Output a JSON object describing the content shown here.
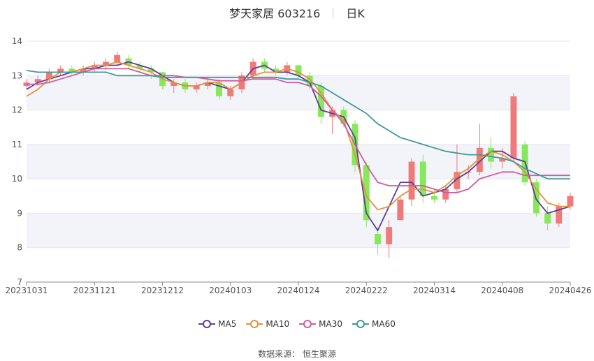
{
  "header": {
    "title": "梦天家居 603216",
    "period": "日K"
  },
  "source": "数据来源：  恒生聚源",
  "chart_data": {
    "type": "candlestick",
    "ylim": [
      7,
      14
    ],
    "yticks": [
      "7",
      "8",
      "9",
      "10",
      "11",
      "12",
      "13",
      "14"
    ],
    "xtick_labels": [
      "20231031",
      "20231121",
      "20231212",
      "20240103",
      "20240124",
      "20240222",
      "20240314",
      "20240408",
      "20240426"
    ],
    "up_color": "#f07a7a",
    "down_color": "#86e85a",
    "series": [
      {
        "name": "MA5",
        "color": "#5b3f93",
        "values": [
          12.6,
          12.8,
          12.9,
          13.0,
          13.1,
          13.2,
          13.2,
          13.3,
          13.3,
          13.4,
          13.3,
          13.2,
          13.0,
          12.8,
          12.7,
          12.7,
          12.8,
          12.7,
          12.6,
          12.8,
          13.2,
          13.3,
          13.1,
          13.1,
          13.0,
          12.8,
          12.0,
          11.9,
          11.8,
          11.2,
          9.0,
          8.5,
          9.2,
          9.9,
          9.9,
          9.5,
          9.6,
          9.7,
          10.0,
          10.2,
          10.5,
          10.8,
          10.8,
          10.6,
          10.5,
          9.4,
          9.0,
          9.1,
          9.2
        ]
      },
      {
        "name": "MA10",
        "color": "#e6913b",
        "values": [
          12.4,
          12.6,
          12.9,
          13.1,
          13.1,
          13.2,
          13.3,
          13.3,
          13.4,
          13.3,
          13.2,
          13.1,
          12.9,
          12.8,
          12.7,
          12.7,
          12.8,
          12.8,
          12.6,
          12.8,
          13.0,
          13.1,
          13.1,
          13.2,
          13.1,
          12.9,
          12.5,
          12.0,
          11.7,
          10.7,
          9.5,
          9.1,
          9.2,
          9.5,
          9.7,
          9.7,
          9.6,
          9.8,
          10.1,
          10.3,
          10.6,
          10.8,
          10.7,
          10.5,
          10.2,
          9.7,
          9.3,
          9.2,
          9.2
        ]
      },
      {
        "name": "MA30",
        "color": "#d05c9f",
        "values": [
          12.75,
          12.75,
          12.8,
          12.9,
          13.0,
          13.1,
          13.2,
          13.2,
          13.2,
          13.2,
          13.1,
          13.0,
          13.0,
          13.0,
          12.95,
          12.95,
          12.9,
          12.85,
          12.85,
          12.85,
          12.9,
          12.9,
          12.9,
          12.8,
          12.8,
          12.7,
          12.4,
          12.0,
          11.6,
          11.0,
          10.4,
          9.9,
          9.8,
          9.8,
          9.8,
          9.8,
          9.7,
          9.6,
          9.6,
          9.7,
          10.0,
          10.1,
          10.2,
          10.2,
          10.1,
          10.1,
          10.1,
          10.1,
          10.1
        ]
      },
      {
        "name": "MA60",
        "color": "#3f9a9c",
        "values": [
          13.15,
          13.1,
          13.1,
          13.1,
          13.1,
          13.1,
          13.1,
          13.1,
          13.0,
          13.0,
          13.0,
          13.0,
          12.95,
          12.95,
          12.95,
          12.95,
          12.95,
          12.95,
          12.95,
          12.95,
          12.95,
          12.95,
          12.95,
          12.9,
          12.9,
          12.8,
          12.7,
          12.5,
          12.3,
          12.1,
          11.9,
          11.6,
          11.4,
          11.2,
          11.1,
          11.0,
          10.9,
          10.8,
          10.75,
          10.7,
          10.7,
          10.65,
          10.6,
          10.5,
          10.3,
          10.15,
          10.0,
          10.0,
          10.0
        ]
      }
    ],
    "candles": [
      [
        12.7,
        12.8,
        12.9,
        12.6
      ],
      [
        12.8,
        12.9,
        13.0,
        12.7
      ],
      [
        12.9,
        13.1,
        13.2,
        12.8
      ],
      [
        13.1,
        13.2,
        13.3,
        13.0
      ],
      [
        13.2,
        13.1,
        13.3,
        13.0
      ],
      [
        13.1,
        13.2,
        13.3,
        13.0
      ],
      [
        13.2,
        13.3,
        13.4,
        13.1
      ],
      [
        13.3,
        13.4,
        13.5,
        13.2
      ],
      [
        13.4,
        13.6,
        13.7,
        13.3
      ],
      [
        13.5,
        13.3,
        13.6,
        13.2
      ],
      [
        13.3,
        13.2,
        13.4,
        13.1
      ],
      [
        13.2,
        13.1,
        13.3,
        12.9
      ],
      [
        13.1,
        12.7,
        13.1,
        12.6
      ],
      [
        12.7,
        12.8,
        12.9,
        12.5
      ],
      [
        12.8,
        12.6,
        12.9,
        12.5
      ],
      [
        12.6,
        12.7,
        12.8,
        12.5
      ],
      [
        12.7,
        12.8,
        12.9,
        12.6
      ],
      [
        12.8,
        12.4,
        12.9,
        12.3
      ],
      [
        12.4,
        12.6,
        12.7,
        12.3
      ],
      [
        12.6,
        13.0,
        13.1,
        12.5
      ],
      [
        13.0,
        13.4,
        13.5,
        12.9
      ],
      [
        13.4,
        13.2,
        13.5,
        13.1
      ],
      [
        13.2,
        13.1,
        13.3,
        13.0
      ],
      [
        13.1,
        13.3,
        13.4,
        13.0
      ],
      [
        13.3,
        13.0,
        13.3,
        12.9
      ],
      [
        13.0,
        12.7,
        13.1,
        12.6
      ],
      [
        12.7,
        11.8,
        12.8,
        11.6
      ],
      [
        11.8,
        12.0,
        12.1,
        11.3
      ],
      [
        12.0,
        11.6,
        12.1,
        11.5
      ],
      [
        11.6,
        10.4,
        11.7,
        10.2
      ],
      [
        10.4,
        8.8,
        10.5,
        8.6
      ],
      [
        8.4,
        8.1,
        8.6,
        7.8
      ],
      [
        8.1,
        8.6,
        8.8,
        7.7
      ],
      [
        8.8,
        9.4,
        9.5,
        8.8
      ],
      [
        9.4,
        10.5,
        10.6,
        9.2
      ],
      [
        10.5,
        9.5,
        10.7,
        9.3
      ],
      [
        9.5,
        9.4,
        9.7,
        9.3
      ],
      [
        9.4,
        9.7,
        9.8,
        9.3
      ],
      [
        9.7,
        10.2,
        11.0,
        9.6
      ],
      [
        10.2,
        10.2,
        10.4,
        10.0
      ],
      [
        10.2,
        10.9,
        11.6,
        10.1
      ],
      [
        10.9,
        10.5,
        11.2,
        10.3
      ],
      [
        10.5,
        10.6,
        10.9,
        10.3
      ],
      [
        10.6,
        12.4,
        12.5,
        10.5
      ],
      [
        11.0,
        9.9,
        11.1,
        9.8
      ],
      [
        9.9,
        9.0,
        10.0,
        8.9
      ],
      [
        9.0,
        8.7,
        9.2,
        8.5
      ],
      [
        8.7,
        9.2,
        9.3,
        8.6
      ],
      [
        9.2,
        9.5,
        9.6,
        9.1
      ]
    ]
  },
  "legend": [
    "MA5",
    "MA10",
    "MA30",
    "MA60"
  ]
}
